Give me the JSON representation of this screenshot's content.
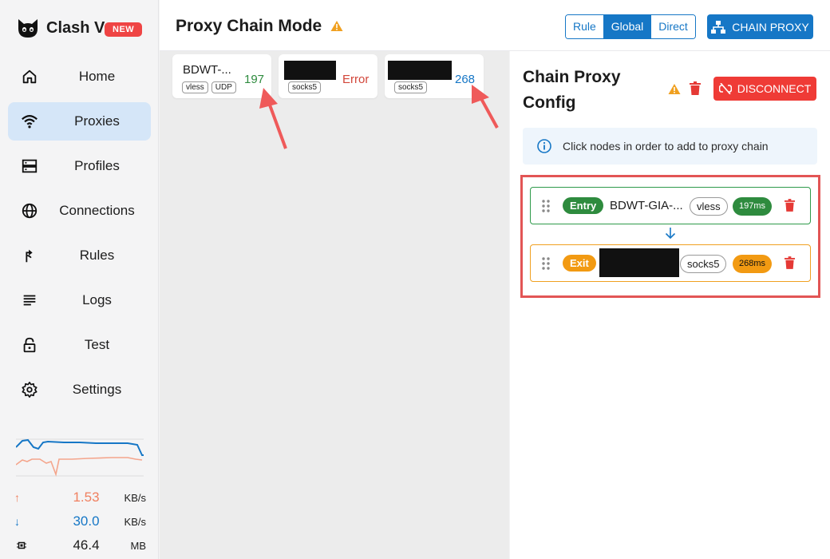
{
  "brand": {
    "name": "Clash Verge",
    "badge": "NEW"
  },
  "sidebar": {
    "items": [
      {
        "label": "Home",
        "icon": "home-icon",
        "active": false
      },
      {
        "label": "Proxies",
        "icon": "wifi-icon",
        "active": true
      },
      {
        "label": "Profiles",
        "icon": "server-icon",
        "active": false
      },
      {
        "label": "Connections",
        "icon": "globe-icon",
        "active": false
      },
      {
        "label": "Rules",
        "icon": "route-icon",
        "active": false
      },
      {
        "label": "Logs",
        "icon": "list-icon",
        "active": false
      },
      {
        "label": "Test",
        "icon": "lock-icon",
        "active": false
      },
      {
        "label": "Settings",
        "icon": "gear-icon",
        "active": false
      }
    ]
  },
  "stats": {
    "upload": {
      "value": "1.53",
      "unit": "KB/s",
      "color": "#f08060"
    },
    "download": {
      "value": "30.0",
      "unit": "KB/s",
      "color": "#1677c6"
    },
    "memory": {
      "value": "46.4",
      "unit": "MB"
    }
  },
  "header": {
    "title": "Proxy Chain Mode",
    "modes": [
      "Rule",
      "Global",
      "Direct"
    ],
    "active_mode": "Global",
    "chain_button": "CHAIN PROXY"
  },
  "proxies": [
    {
      "name": "BDWT-...",
      "tags": [
        "vless",
        "UDP"
      ],
      "delay": "197",
      "delay_color": "#2e8b3e",
      "redacted": false
    },
    {
      "name": "",
      "tags": [
        "socks5"
      ],
      "delay": "Error",
      "delay_color": "#d2463a",
      "redacted": true
    },
    {
      "name": "",
      "tags": [
        "socks5"
      ],
      "delay": "268",
      "delay_color": "#1677c6",
      "redacted": true
    }
  ],
  "panel": {
    "title": "Chain Proxy Config",
    "disconnect_label": "DISCONNECT",
    "info": "Click nodes in order to add to proxy chain",
    "chain": [
      {
        "role": "Entry",
        "name": "BDWT-GIA-...",
        "protocol": "vless",
        "latency": "197ms"
      },
      {
        "role": "Exit",
        "name": "",
        "protocol": "socks5",
        "latency": "268ms"
      }
    ]
  },
  "colors": {
    "accent": "#1677c6",
    "danger": "#ef3b36",
    "warning": "#f29a12",
    "success": "#2e8b3e"
  }
}
